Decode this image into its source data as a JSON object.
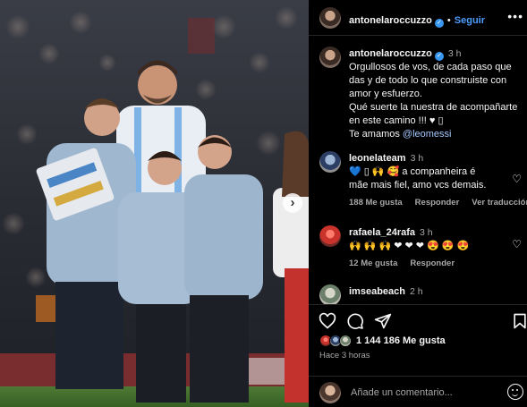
{
  "post": {
    "author": "antonelaroccuzzo",
    "follow_label": "Seguir",
    "more_label": "•••"
  },
  "caption": {
    "username": "antonelaroccuzzo",
    "time": "3 h",
    "lines": [
      "Orgullosos de vos, de cada paso que",
      "das y de todo lo que construiste  con",
      "amor y esfuerzo.",
      "Qué suerte la nuestra de acompañarte",
      "en este camino !!! ♥ ▯"
    ],
    "closing": "Te amamos",
    "mention": "@leomessi"
  },
  "comments": [
    {
      "username": "leonelateam",
      "time": "3 h",
      "text_line1": "💙 ▯ 🙌 🥰  a companheira é",
      "text_line2": "mãe mais fiel, amo vcs demais.",
      "likes": "188 Me gusta",
      "reply": "Responder",
      "translate": "Ver traducción"
    },
    {
      "username": "rafaela_24rafa",
      "time": "3 h",
      "text_line1": "🙌 🙌 🙌 ❤ ❤ ❤ 😍 😍 😍",
      "likes": "12 Me gusta",
      "reply": "Responder"
    },
    {
      "username": "imseabeach",
      "time": "2 h"
    }
  ],
  "stats": {
    "likes": "1 144 186 Me gusta",
    "posted_ago": "Hace 3 horas"
  },
  "add_comment": {
    "placeholder": "Añade un comentario..."
  },
  "icons": {
    "like": "heart-icon",
    "comment": "comment-icon",
    "share": "send-icon",
    "save": "bookmark-icon",
    "emoji": "emoji-icon",
    "verified": "verified-badge-icon"
  },
  "colors": {
    "background": "#000000",
    "link": "#4c9dfc",
    "verified": "#3897f0",
    "secondary_text": "#a8a8a8"
  }
}
